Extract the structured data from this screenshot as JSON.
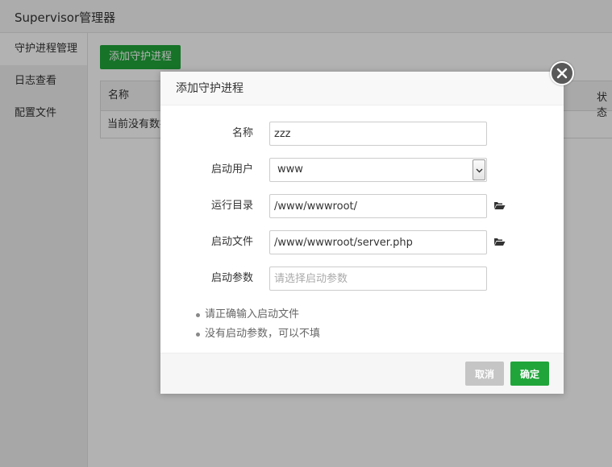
{
  "app": {
    "title": "Supervisor管理器"
  },
  "sidebar": {
    "items": [
      {
        "label": "守护进程管理",
        "active": true
      },
      {
        "label": "日志查看",
        "active": false
      },
      {
        "label": "配置文件",
        "active": false
      }
    ]
  },
  "main": {
    "add_button": "添加守护进程",
    "table": {
      "columns": [
        "名称",
        "状态"
      ],
      "empty_text": "当前没有数据"
    }
  },
  "dialog": {
    "title": "添加守护进程",
    "fields": {
      "name": {
        "label": "名称",
        "value": "zzz"
      },
      "user": {
        "label": "启动用户",
        "value": "www"
      },
      "dir": {
        "label": "运行目录",
        "value": "/www/wwwroot/"
      },
      "file": {
        "label": "启动文件",
        "value": "/www/wwwroot/server.php"
      },
      "params": {
        "label": "启动参数",
        "value": "",
        "placeholder": "请选择启动参数"
      }
    },
    "tips": [
      "请正确输入启动文件",
      "没有启动参数，可以不填"
    ],
    "cancel_label": "取消",
    "confirm_label": "确定"
  },
  "colors": {
    "accent": "#20a53a",
    "cancel": "#c5c5c5",
    "overlay": "rgba(0,0,0,0.3)",
    "close_button": "#595959"
  },
  "icons": {
    "folder": "folder-open-icon",
    "close": "close-icon",
    "dropdown": "chevron-down-icon"
  }
}
